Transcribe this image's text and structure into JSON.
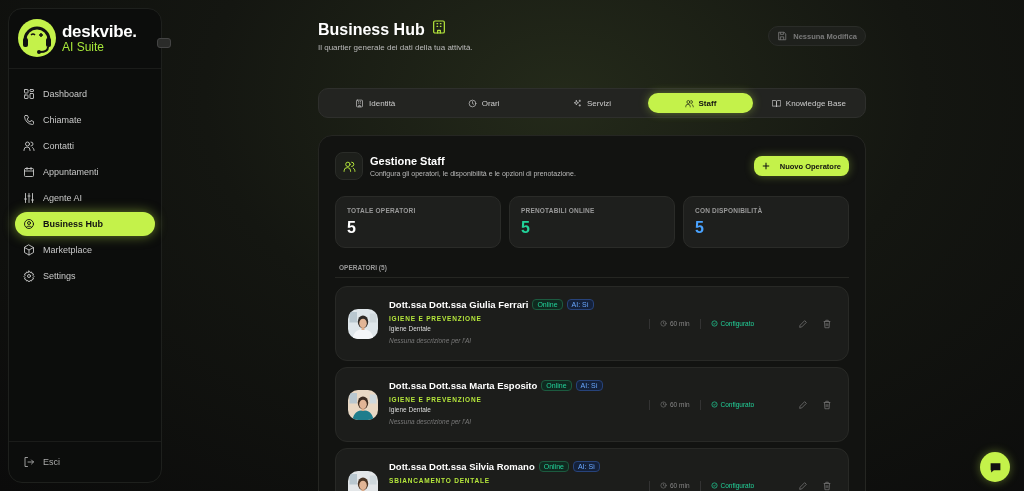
{
  "brand": {
    "name": "deskvibe.",
    "subtitle": "AI Suite"
  },
  "sidebar": {
    "items": [
      {
        "label": "Dashboard",
        "selected": false
      },
      {
        "label": "Chiamate",
        "selected": false
      },
      {
        "label": "Contatti",
        "selected": false
      },
      {
        "label": "Appuntamenti",
        "selected": false
      },
      {
        "label": "Agente AI",
        "selected": false
      },
      {
        "label": "Business Hub",
        "selected": true
      },
      {
        "label": "Marketplace",
        "selected": false
      },
      {
        "label": "Settings",
        "selected": false
      }
    ],
    "logout": "Esci"
  },
  "header": {
    "title": "Business Hub",
    "subtitle": "Il quartier generale dei dati della tua attività.",
    "save_button": {
      "label": "Nessuna Modifica",
      "disabled": true
    }
  },
  "tabs": [
    {
      "label": "Identità",
      "selected": false
    },
    {
      "label": "Orari",
      "selected": false
    },
    {
      "label": "Servizi",
      "selected": false
    },
    {
      "label": "Staff",
      "selected": true
    },
    {
      "label": "Knowledge Base",
      "selected": false
    }
  ],
  "panel": {
    "title": "Gestione Staff",
    "subtitle": "Configura gli operatori, le disponibilità e le opzioni di prenotazione.",
    "add_button": "Nuovo Operatore",
    "stats": [
      {
        "label": "TOTALE OPERATORI",
        "value": "5",
        "color": "#ffffff"
      },
      {
        "label": "PRENOTABILI ONLINE",
        "value": "5",
        "color": "#22d39a"
      },
      {
        "label": "CON DISPONIBILITÀ",
        "value": "5",
        "color": "#4aa3ff"
      }
    ],
    "list_title": "OPERATORI (5)",
    "operators": [
      {
        "name": "Dott.ssa Dott.ssa Giulia Ferrari",
        "badges": [
          {
            "label": "Online",
            "kind": "online"
          },
          {
            "label": "AI: Sì",
            "kind": "ai"
          }
        ],
        "specialty": "IGIENE E PREVENZIONE",
        "role": "Igiene Dentale",
        "description": "Nessuna descrizione per l'AI",
        "duration": "60 min",
        "status": "Configurato"
      },
      {
        "name": "Dott.ssa Dott.ssa Marta Esposito",
        "badges": [
          {
            "label": "Online",
            "kind": "online"
          },
          {
            "label": "AI: Sì",
            "kind": "ai"
          }
        ],
        "specialty": "IGIENE E PREVENZIONE",
        "role": "Igiene Dentale",
        "description": "Nessuna descrizione per l'AI",
        "duration": "60 min",
        "status": "Configurato"
      },
      {
        "name": "Dott.ssa Dott.ssa Silvia Romano",
        "badges": [
          {
            "label": "Online",
            "kind": "online"
          },
          {
            "label": "AI: Sì",
            "kind": "ai"
          }
        ],
        "specialty": "SBIANCAMENTO DENTALE",
        "duration": "60 min",
        "status": "Configurato"
      }
    ]
  }
}
